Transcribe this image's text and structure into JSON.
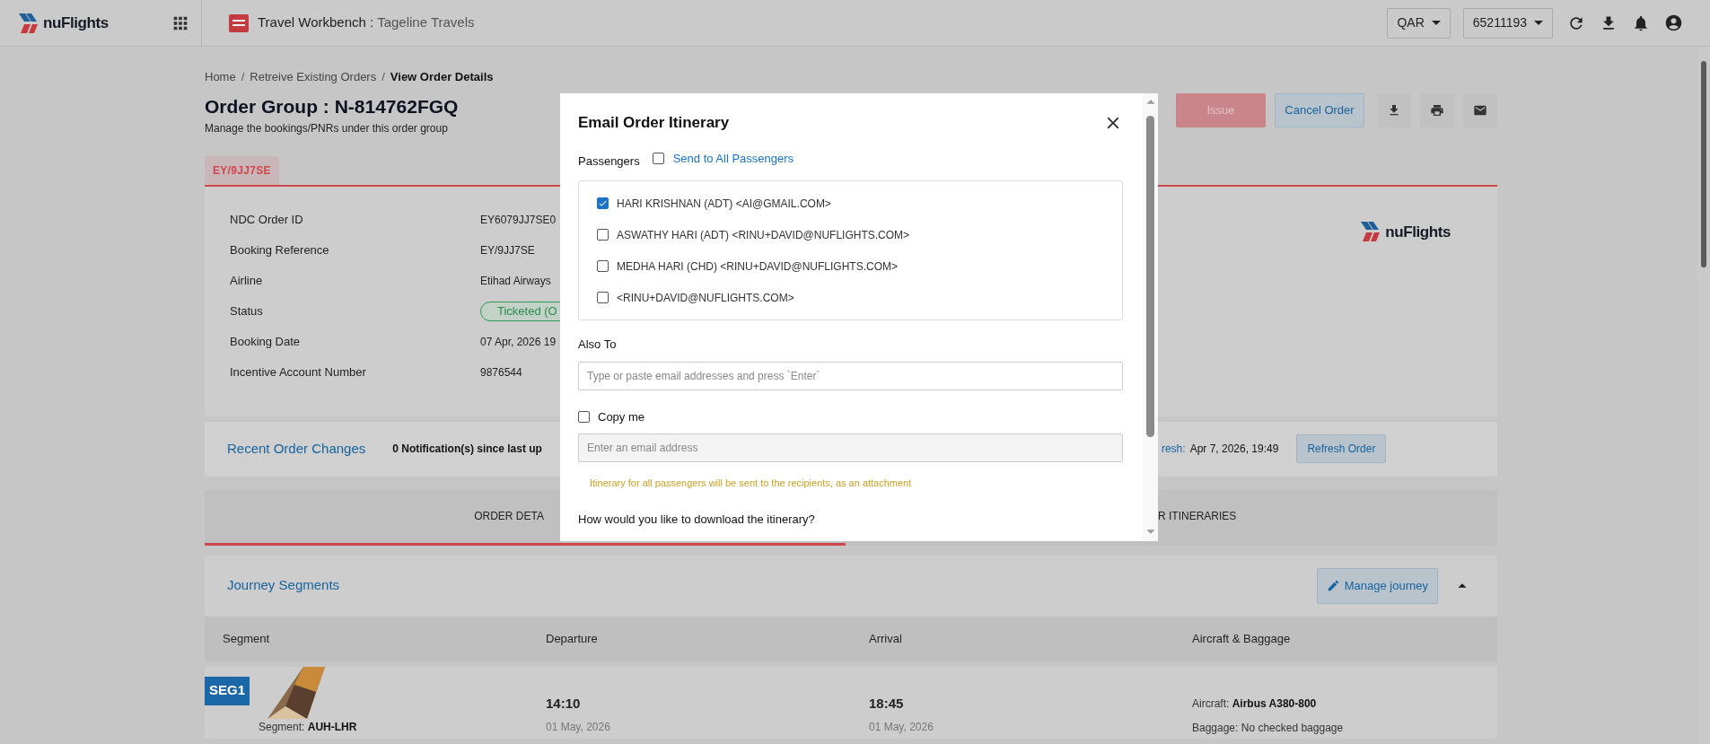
{
  "header": {
    "logo": "nuFlights",
    "app_title": "Travel Workbench :",
    "agency": "Tageline Travels",
    "currency": "QAR",
    "account": "65211193"
  },
  "breadcrumb": {
    "separator": "/",
    "items": [
      {
        "label": "Home",
        "current": false
      },
      {
        "label": "Retreive Existing Orders",
        "current": false
      },
      {
        "label": "View Order Details",
        "current": true
      }
    ]
  },
  "order_group": {
    "title": "Order Group : N-814762FGQ",
    "subtitle": "Manage the bookings/PNRs under this order group"
  },
  "actions": {
    "issue": {
      "label": "Issue",
      "disabled": true
    },
    "cancel": "Cancel Order"
  },
  "pnr_tabs": [
    {
      "label": "EY/9JJ7SE",
      "selected": true
    }
  ],
  "details": [
    {
      "kind": "text",
      "label": "NDC Order ID",
      "value": "EY6079JJ7SE0"
    },
    {
      "kind": "text",
      "label": "Booking Reference",
      "value": "EY/9JJ7SE"
    },
    {
      "kind": "text",
      "label": "Airline",
      "value": "Etihad Airways"
    },
    {
      "kind": "badge",
      "label": "Status",
      "value": "Ticketed (O"
    },
    {
      "kind": "text",
      "label": "Booking Date",
      "value": "07 Apr, 2026 19"
    },
    {
      "kind": "text",
      "label": "Incentive Account Number",
      "value": "9876544"
    }
  ],
  "card_logo": "nuFlights",
  "recent_changes": {
    "title": "Recent Order Changes",
    "notifications": "0 Notification(s) since last up",
    "refresh_label": "resh:",
    "refresh_time": "Apr 7, 2026, 19:49",
    "button": "Refresh Order"
  },
  "view_tabs": [
    {
      "label": "ORDER DETA",
      "selected": true
    },
    {
      "label": "R ITINERARIES",
      "selected": false
    }
  ],
  "journey": {
    "title": "Journey Segments",
    "button": "Manage journey",
    "expanded": true,
    "columns": [
      "Segment",
      "Departure",
      "Arrival",
      "Aircraft & Baggage"
    ],
    "segments": [
      {
        "badge": "SEG1",
        "route_label": "Segment:",
        "route": "AUH-LHR",
        "departure_time": "14:10",
        "departure_date": "01 May, 2026",
        "arrival_time": "18:45",
        "arrival_date": "01 May, 2026",
        "aircraft_label": "Aircraft:",
        "aircraft": "Airbus A380-800",
        "baggage_label": "Baggage:",
        "baggage": "No checked baggage"
      }
    ]
  },
  "modal": {
    "title": "Email Order Itinerary",
    "passengers_label": "Passengers",
    "send_all": {
      "label": "Send to All Passengers",
      "checked": false
    },
    "passengers": [
      {
        "label": "HARI KRISHNAN (ADT) <AI@GMAIL.COM>",
        "checked": true
      },
      {
        "label": "ASWATHY HARI (ADT) <RINU+DAVID@NUFLIGHTS.COM>",
        "checked": false
      },
      {
        "label": "MEDHA HARI (CHD) <RINU+DAVID@NUFLIGHTS.COM>",
        "checked": false
      },
      {
        "label": "<RINU+DAVID@NUFLIGHTS.COM>",
        "checked": false
      }
    ],
    "also_to": {
      "label": "Also To",
      "placeholder": "Type or paste email addresses and press `Enter`"
    },
    "copy_me": {
      "label": "Copy me",
      "checked": false,
      "placeholder": "Enter an email address"
    },
    "note": "Itinerary for all passengers will be sent to the recipients, as an attachment",
    "question": "How would you like to download the itinerary?"
  }
}
